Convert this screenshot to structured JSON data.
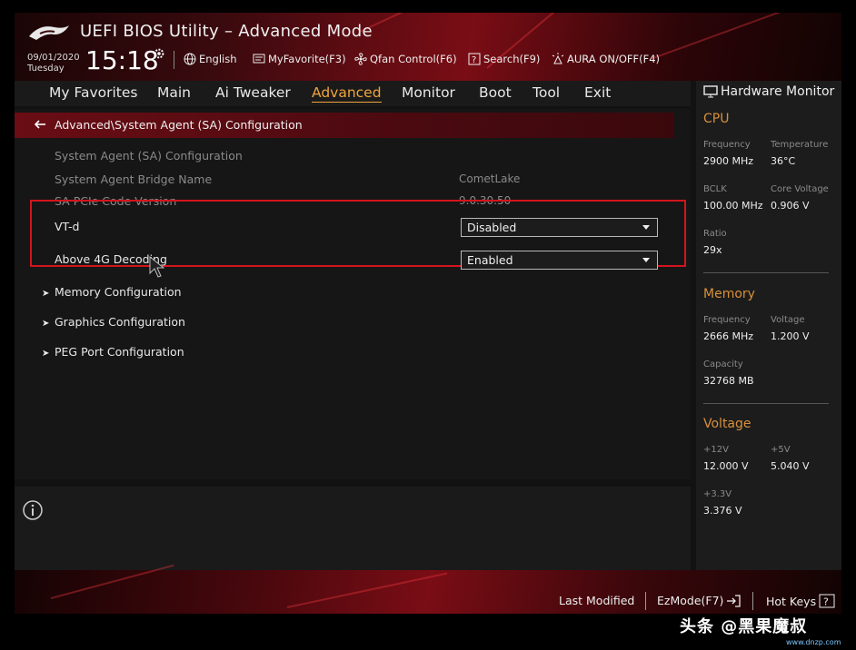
{
  "header": {
    "title": "UEFI BIOS Utility – Advanced Mode",
    "date": "09/01/2020",
    "day": "Tuesday",
    "time": "15:18",
    "tools": {
      "language": "English",
      "myfavorite": "MyFavorite(F3)",
      "qfan": "Qfan Control(F6)",
      "search": "Search(F9)",
      "aura": "AURA ON/OFF(F4)"
    }
  },
  "nav": {
    "tabs": [
      "My Favorites",
      "Main",
      "Ai Tweaker",
      "Advanced",
      "Monitor",
      "Boot",
      "Tool",
      "Exit"
    ],
    "active": "Advanced"
  },
  "main": {
    "breadcrumb": "Advanced\\System Agent (SA) Configuration",
    "section_title": "System Agent (SA) Configuration",
    "info_rows": [
      {
        "label": "System Agent Bridge Name",
        "value": "CometLake"
      },
      {
        "label": "SA PCIe Code Version",
        "value": "9.0.30.50"
      }
    ],
    "settings": [
      {
        "label": "VT-d",
        "value": "Disabled"
      },
      {
        "label": "Above 4G Decoding",
        "value": "Enabled"
      }
    ],
    "submenus": [
      "Memory Configuration",
      "Graphics Configuration",
      "PEG Port Configuration"
    ]
  },
  "hardware_monitor": {
    "title": "Hardware Monitor",
    "cpu": {
      "heading": "CPU",
      "frequency_label": "Frequency",
      "frequency": "2900 MHz",
      "temperature_label": "Temperature",
      "temperature": "36°C",
      "bclk_label": "BCLK",
      "bclk": "100.00 MHz",
      "core_voltage_label": "Core Voltage",
      "core_voltage": "0.906 V",
      "ratio_label": "Ratio",
      "ratio": "29x"
    },
    "memory": {
      "heading": "Memory",
      "frequency_label": "Frequency",
      "frequency": "2666 MHz",
      "voltage_label": "Voltage",
      "voltage": "1.200 V",
      "capacity_label": "Capacity",
      "capacity": "32768 MB"
    },
    "voltage": {
      "heading": "Voltage",
      "v12_label": "+12V",
      "v12": "12.000 V",
      "v5_label": "+5V",
      "v5": "5.040 V",
      "v33_label": "+3.3V",
      "v33": "3.376 V"
    }
  },
  "footer": {
    "last_modified": "Last Modified",
    "ezmode": "EzMode(F7)",
    "hotkeys": "Hot Keys"
  },
  "watermark": {
    "text": "头条 @黑果魔叔",
    "site": "www.dnzp.com"
  },
  "colors": {
    "accent": "#f0a43c",
    "highlight_border": "#d4141c",
    "header_red": "#7a0d15"
  }
}
